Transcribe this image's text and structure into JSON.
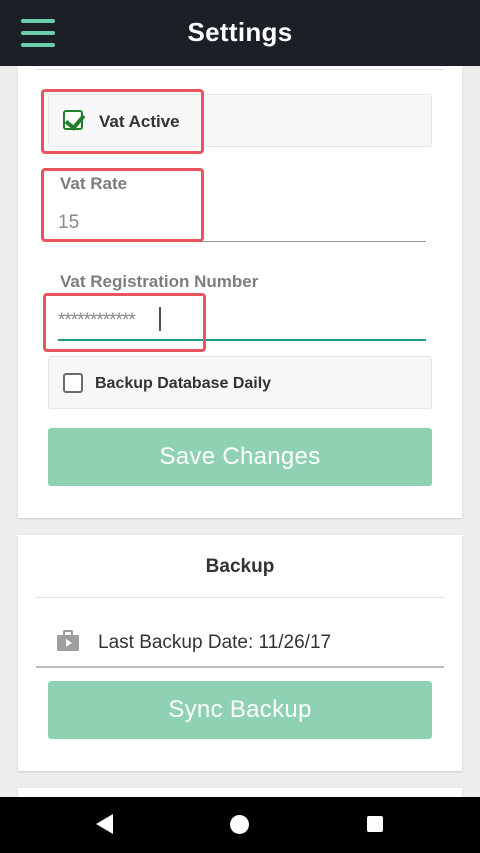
{
  "appbar": {
    "title": "Settings",
    "menu_icon": "hamburger-menu-icon"
  },
  "settings_card": {
    "vat_active": {
      "label": "Vat Active",
      "checked": true
    },
    "vat_rate": {
      "label": "Vat Rate",
      "value": "15"
    },
    "vat_registration": {
      "label": "Vat Registration Number",
      "value": "************"
    },
    "backup_daily": {
      "label": "Backup Database Daily",
      "checked": false
    },
    "save_button": "Save Changes"
  },
  "backup_card": {
    "title": "Backup",
    "last_backup": "Last Backup Date: 11/26/17",
    "icon": "briefcase-icon",
    "sync_button": "Sync Backup"
  },
  "navbar": {
    "back_icon": "back-icon",
    "home_icon": "home-icon",
    "recent_icon": "recent-apps-icon"
  },
  "colors": {
    "appbar_bg": "#1b1f26",
    "accent": "#6ccda9",
    "button_bg": "#8fd1b3",
    "check_green": "#1f7f2b",
    "highlight_red": "#e9545f",
    "active_underline": "#1a9b84"
  }
}
